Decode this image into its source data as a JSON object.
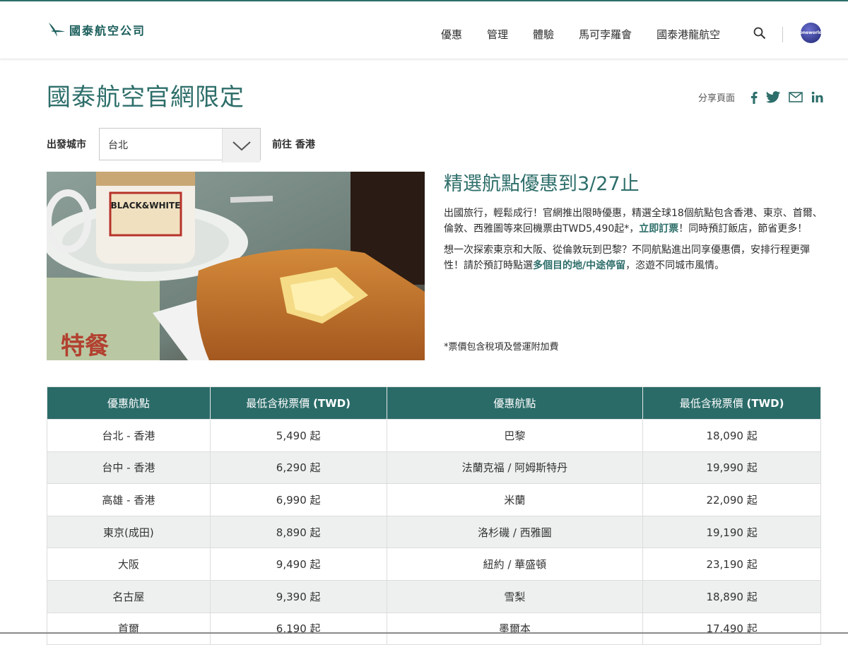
{
  "header": {
    "brand": "國泰航空公司",
    "nav": [
      "優惠",
      "管理",
      "體驗",
      "馬可孛羅會",
      "國泰港龍航空"
    ],
    "oneworld_label": "oneworld"
  },
  "page": {
    "title": "國泰航空官網限定",
    "share_label": "分享頁面"
  },
  "search": {
    "origin_label": "出發城市",
    "origin_value": "台北",
    "destination_label": "前往 香港"
  },
  "hero_image_text": "BLACK&WHITE",
  "promo": {
    "heading": "精選航點優惠到3/27止",
    "p1_start": "出國旅行，輕鬆成行！官網推出限時優惠，精選全球18個航點包含香港、東京、首爾、倫敦、西雅圖等來回機票由TWD5,490起*，",
    "p1_link": "立即訂票",
    "p1_end": "！同時預訂飯店，節省更多！",
    "p2_start": "想一次探索東京和大阪、從倫敦玩到巴黎？不同航點進出同享優惠價，安排行程更彈性！請於預訂時點選",
    "p2_link": "多個目的地/中途停留",
    "p2_end": "，恣遊不同城市風情。",
    "note": "*票價包含稅項及營運附加費"
  },
  "table": {
    "headers": [
      "優惠航點",
      "最低含稅票價",
      "(TWD)",
      "優惠航點",
      "最低含稅票價",
      "(TWD)"
    ],
    "rows": [
      [
        "台北 - 香港",
        "5,490 起",
        "巴黎",
        "18,090 起"
      ],
      [
        "台中 - 香港",
        "6,290 起",
        "法蘭克福 / 阿姆斯特丹",
        "19,990 起"
      ],
      [
        "高雄 - 香港",
        "6,990 起",
        "米蘭",
        "22,090 起"
      ],
      [
        "東京(成田)",
        "8,890 起",
        "洛杉磯 / 西雅圖",
        "19,190 起"
      ],
      [
        "大阪",
        "9,490 起",
        "紐約 / 華盛頓",
        "23,190 起"
      ],
      [
        "名古屋",
        "9,390 起",
        "雪梨",
        "18,890 起"
      ],
      [
        "首爾",
        "6,190 起",
        "墨爾本",
        "17,490 起"
      ]
    ]
  },
  "colors": {
    "brand_teal": "#2d6e6a",
    "table_header": "#2a6b68",
    "row_alt": "#eef0f0"
  },
  "icons": [
    "cathay-logo-icon",
    "search-icon",
    "oneworld-logo",
    "facebook-icon",
    "twitter-icon",
    "mail-icon",
    "linkedin-icon",
    "chevron-down-icon"
  ]
}
